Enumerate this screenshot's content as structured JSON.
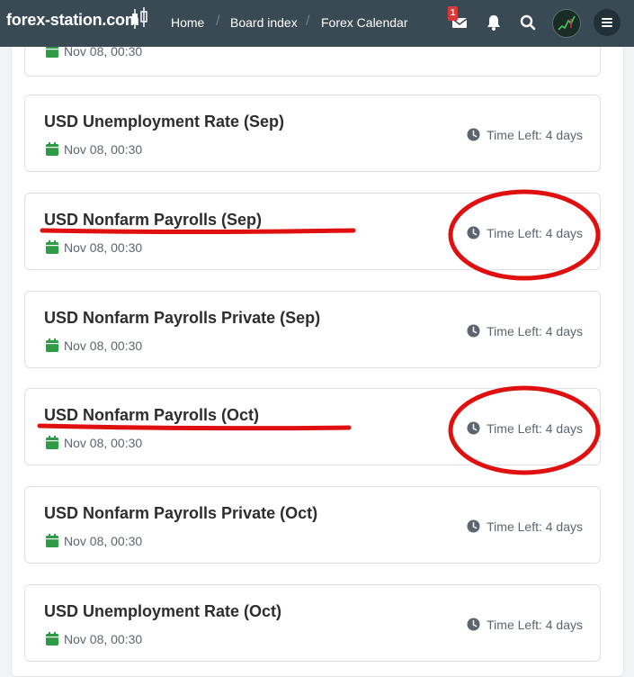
{
  "header": {
    "logo_text": "forex-station.com",
    "nav": [
      "Home",
      "Board index",
      "Forex Calendar"
    ],
    "mail_badge": "1"
  },
  "partial_event": {
    "date": "Nov 08, 00:30"
  },
  "events": [
    {
      "title": "USD Unemployment Rate (Sep)",
      "date": "Nov 08, 00:30",
      "time_left": "Time Left: 4 days"
    },
    {
      "title": "USD Nonfarm Payrolls (Sep)",
      "date": "Nov 08, 00:30",
      "time_left": "Time Left: 4 days"
    },
    {
      "title": "USD Nonfarm Payrolls Private (Sep)",
      "date": "Nov 08, 00:30",
      "time_left": "Time Left: 4 days"
    },
    {
      "title": "USD Nonfarm Payrolls (Oct)",
      "date": "Nov 08, 00:30",
      "time_left": "Time Left: 4 days"
    },
    {
      "title": "USD Nonfarm Payrolls Private (Oct)",
      "date": "Nov 08, 00:30",
      "time_left": "Time Left: 4 days"
    },
    {
      "title": "USD Unemployment Rate (Oct)",
      "date": "Nov 08, 00:30",
      "time_left": "Time Left: 4 days"
    }
  ],
  "colors": {
    "header_bg": "#3a4a54",
    "calendar_green": "#2e9b45",
    "annotation_red": "#e01010"
  },
  "icons": [
    "candlestick-logo-icon",
    "envelope-icon",
    "bell-icon",
    "search-icon",
    "hamburger-menu-icon",
    "calendar-icon",
    "clock-icon"
  ]
}
